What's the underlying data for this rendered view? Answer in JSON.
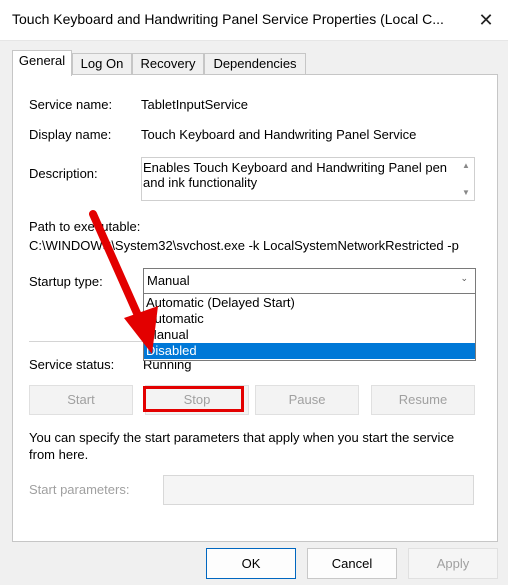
{
  "window": {
    "title": "Touch Keyboard and Handwriting Panel Service Properties (Local C...",
    "close_glyph": "✕"
  },
  "tabs": [
    {
      "label": "General",
      "active": true
    },
    {
      "label": "Log On",
      "active": false
    },
    {
      "label": "Recovery",
      "active": false
    },
    {
      "label": "Dependencies",
      "active": false
    }
  ],
  "general": {
    "service_name_label": "Service name:",
    "service_name_value": "TabletInputService",
    "display_name_label": "Display name:",
    "display_name_value": "Touch Keyboard and Handwriting Panel Service",
    "description_label": "Description:",
    "description_value": "Enables Touch Keyboard and Handwriting Panel pen and ink functionality",
    "path_label": "Path to executable:",
    "path_value": "C:\\WINDOWS\\System32\\svchost.exe -k LocalSystemNetworkRestricted -p",
    "startup_type_label": "Startup type:",
    "startup_type_value": "Manual",
    "startup_options": [
      {
        "label": "Automatic (Delayed Start)",
        "selected": false
      },
      {
        "label": "Automatic",
        "selected": false
      },
      {
        "label": "Manual",
        "selected": false
      },
      {
        "label": "Disabled",
        "selected": true
      }
    ],
    "service_status_label": "Service status:",
    "service_status_value": "Running",
    "buttons": {
      "start": "Start",
      "stop": "Stop",
      "pause": "Pause",
      "resume": "Resume"
    },
    "help_text": "You can specify the start parameters that apply when you start the service from here.",
    "start_params_label": "Start parameters:",
    "start_params_value": ""
  },
  "footer": {
    "ok": "OK",
    "cancel": "Cancel",
    "apply": "Apply"
  },
  "colors": {
    "selection": "#0078d7",
    "annotation_red": "#e30000"
  }
}
